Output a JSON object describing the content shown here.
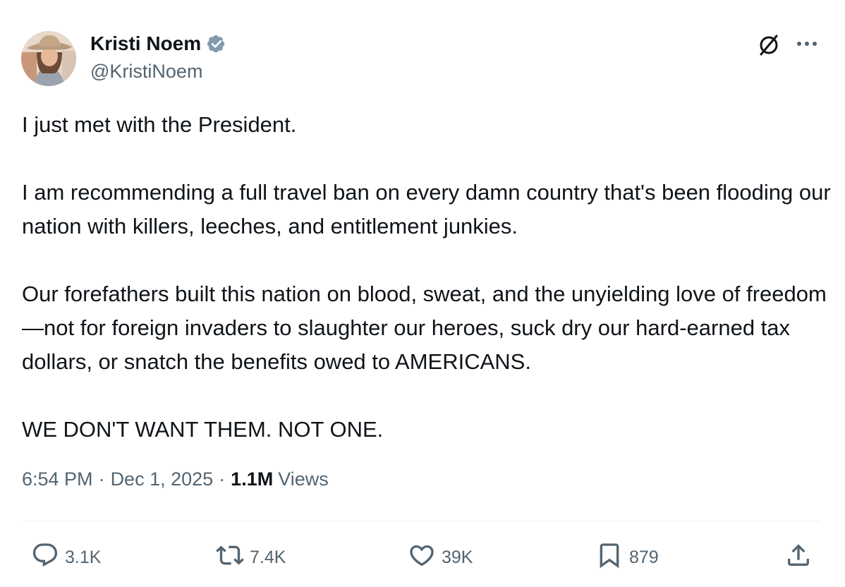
{
  "author": {
    "display_name": "Kristi Noem",
    "handle": "@KristiNoem",
    "verified_icon": "verified-badge-icon",
    "verified_color": "#829aab"
  },
  "header_actions": {
    "grok_icon": "grok-icon",
    "more_icon": "more-dots-icon"
  },
  "post": {
    "paragraphs": [
      "I just met with the President.",
      "I am recommending a full travel ban on every damn country that's been flooding our nation with killers, leeches, and entitlement junkies.",
      "Our forefathers built this nation on blood, sweat, and the unyielding love of freedom—not for foreign invaders to slaughter our heroes, suck dry our hard-earned tax dollars, or snatch the benefits owed to AMERICANS.",
      "WE DON'T WANT THEM. NOT ONE."
    ]
  },
  "meta": {
    "time": "6:54 PM",
    "date": "Dec 1, 2025",
    "separator": "·",
    "views_count": "1.1M",
    "views_label": "Views"
  },
  "actions": {
    "reply": {
      "icon": "reply-icon",
      "count": "3.1K"
    },
    "retweet": {
      "icon": "retweet-icon",
      "count": "7.4K"
    },
    "like": {
      "icon": "heart-icon",
      "count": "39K"
    },
    "bookmark": {
      "icon": "bookmark-icon",
      "count": "879"
    },
    "share": {
      "icon": "share-icon"
    }
  },
  "colors": {
    "text": "#0f1419",
    "secondary": "#536471",
    "divider": "#eff3f4"
  }
}
